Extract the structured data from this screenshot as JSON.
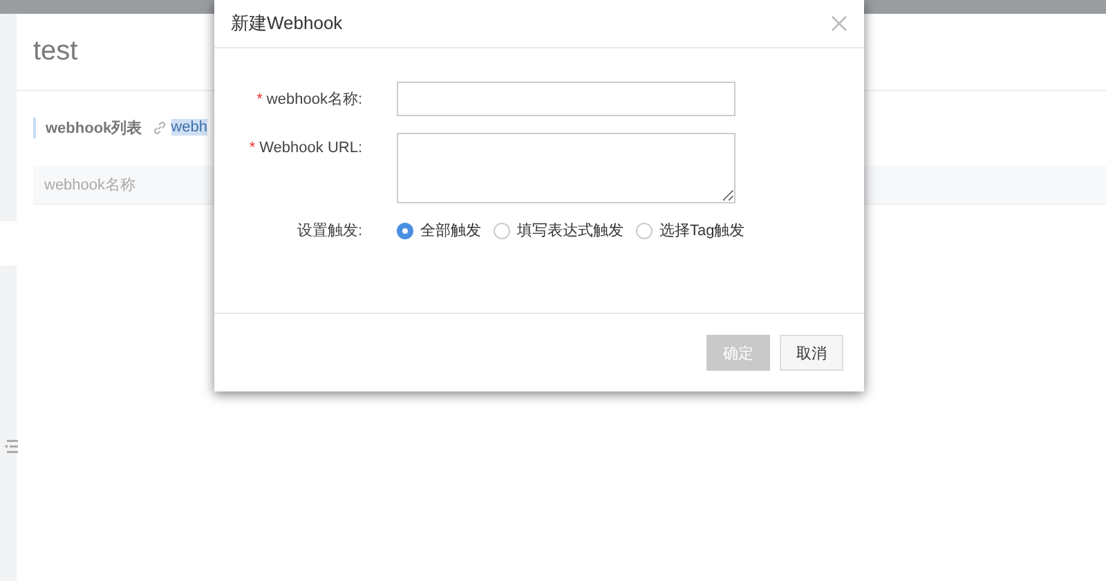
{
  "page": {
    "title": "test",
    "section_title": "webhook列表",
    "link_text": "webh",
    "table": {
      "columns": [
        "webhook名称"
      ]
    }
  },
  "dialog": {
    "title": "新建Webhook",
    "fields": [
      {
        "kind": "input",
        "required_mark": "*",
        "label": "webhook名称:"
      },
      {
        "kind": "textarea",
        "required_mark": "*",
        "label": "Webhook URL:"
      }
    ],
    "trigger": {
      "label": "设置触发:",
      "options": [
        {
          "label": "全部触发",
          "selected": true
        },
        {
          "label": "填写表达式触发",
          "selected": false
        },
        {
          "label": "选择Tag触发",
          "selected": false
        }
      ]
    },
    "buttons": [
      {
        "label": "确定",
        "disabled": true
      },
      {
        "label": "取消",
        "disabled": false
      }
    ]
  }
}
